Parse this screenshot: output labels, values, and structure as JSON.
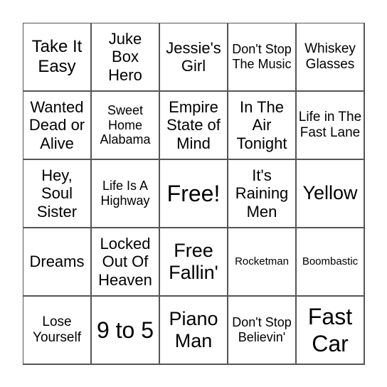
{
  "bingo": {
    "cells": [
      "Take It Easy",
      "Juke Box Hero",
      "Jessie's Girl",
      "Don't Stop The Music",
      "Whiskey Glasses",
      "Wanted Dead or Alive",
      "Sweet Home Alabama",
      "Empire State of Mind",
      "In The Air Tonight",
      "Life in The Fast Lane",
      "Hey, Soul Sister",
      "Life Is A Highway",
      "Free!",
      "It's Raining Men",
      "Yellow",
      "Dreams",
      "Locked Out Of Heaven",
      "Free Fallin'",
      "Rocketman",
      "Boombastic",
      "Lose Yourself",
      "9 to 5",
      "Piano Man",
      "Don't Stop Believin'",
      "Fast Car"
    ],
    "free_space": "Free!"
  }
}
